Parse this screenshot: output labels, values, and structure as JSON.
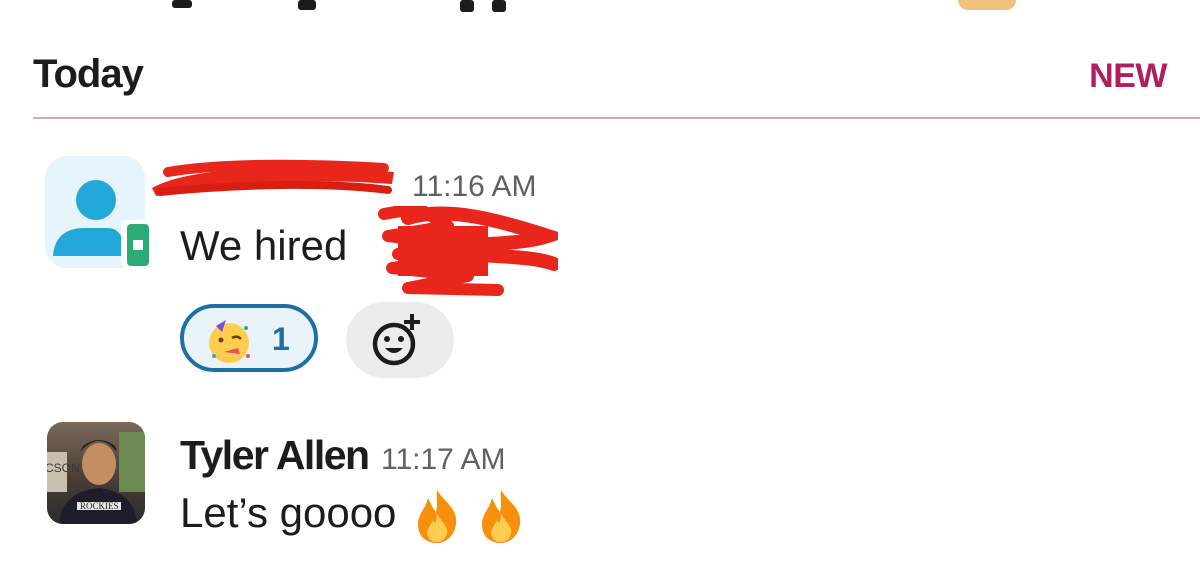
{
  "section": {
    "title": "Today",
    "new_label": "NEW"
  },
  "messages": [
    {
      "sender": "",
      "time": "11:16 AM",
      "text": "We hired",
      "avatar": "generic-user-guest-icon",
      "reactions": [
        {
          "emoji": "partying-face-icon",
          "count": "1"
        }
      ],
      "add_reaction_icon": "add-emoji-icon"
    },
    {
      "sender": "Tyler Allen",
      "time": "11:17 AM",
      "text": "Let’s goooo",
      "avatar": "user-photo",
      "trailing_icons": [
        "fire-icon",
        "fire-icon"
      ]
    }
  ],
  "colors": {
    "accent_new": "#b01e5c",
    "divider": "#d7a7bf",
    "reaction_border": "#1d6fa5",
    "redaction": "#e8261b"
  }
}
